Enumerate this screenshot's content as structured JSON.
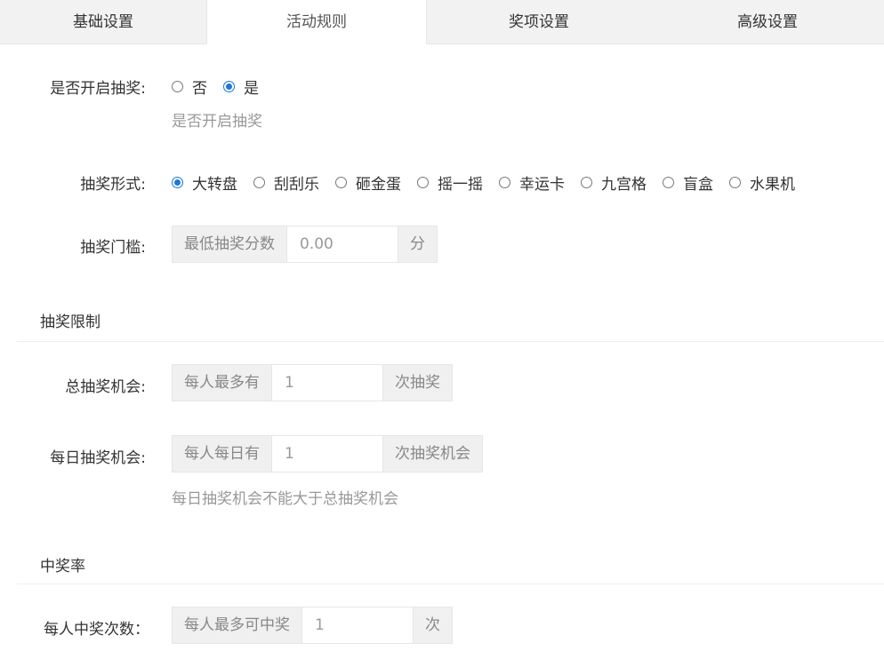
{
  "tabs": [
    {
      "label": "基础设置"
    },
    {
      "label": "活动规则"
    },
    {
      "label": "奖项设置"
    },
    {
      "label": "高级设置"
    }
  ],
  "lottery_enable": {
    "label": "是否开启抽奖:",
    "options": [
      "否",
      "是"
    ],
    "selected": "是",
    "hint": "是否开启抽奖"
  },
  "lottery_form": {
    "label": "抽奖形式:",
    "options": [
      "大转盘",
      "刮刮乐",
      "砸金蛋",
      "摇一摇",
      "幸运卡",
      "九宫格",
      "盲盒",
      "水果机"
    ],
    "selected": "大转盘"
  },
  "threshold": {
    "label": "抽奖门槛:",
    "prefix": "最低抽奖分数",
    "placeholder": "0.00",
    "suffix": "分"
  },
  "limits_section": {
    "title": "抽奖限制"
  },
  "total_chances": {
    "label": "总抽奖机会:",
    "prefix": "每人最多有",
    "value": "1",
    "suffix": "次抽奖"
  },
  "daily_chances": {
    "label": "每日抽奖机会:",
    "prefix": "每人每日有",
    "value": "1",
    "suffix": "次抽奖机会",
    "hint": "每日抽奖机会不能大于总抽奖机会"
  },
  "win_rate_section": {
    "title": "中奖率"
  },
  "win_times": {
    "label": "每人中奖次数：",
    "prefix": "每人最多可中奖",
    "value": "1",
    "suffix": "次"
  },
  "colors": {
    "accent": "#1e78d8",
    "hint": "#999999",
    "addon_bg": "#f0f0f0",
    "tab_bg": "#f2f2f2"
  }
}
